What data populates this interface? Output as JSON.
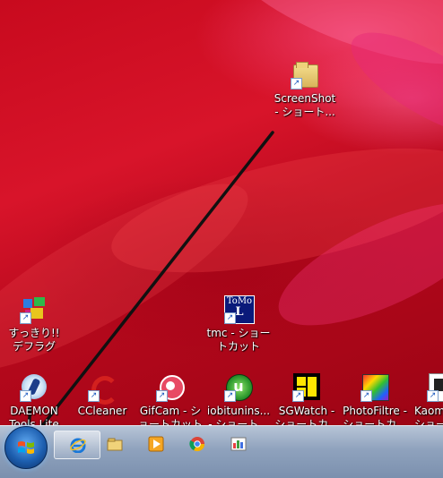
{
  "desktop": {
    "icons": [
      {
        "label": "ScreenShot\n- ショート...",
        "icon": "folder-icon"
      },
      {
        "label": "すっきり!!\nデフラグ",
        "icon": "defrag-icon"
      },
      {
        "label": "tmc - ショー\nトカット",
        "icon": "tomo-icon"
      },
      {
        "label": "DAEMON\nTools Lite",
        "icon": "daemon-tools-icon"
      },
      {
        "label": "CCleaner",
        "icon": "ccleaner-icon"
      },
      {
        "label": "GifCam - シ\nョートカット",
        "icon": "gifcam-icon"
      },
      {
        "label": "iobitunins...\n- ショート...",
        "icon": "iobit-uninstaller-icon"
      },
      {
        "label": "SGWatch -\nショートカ...",
        "icon": "sgwatch-icon"
      },
      {
        "label": "PhotoFiltre -\nショートカ...",
        "icon": "photofiltre-icon"
      },
      {
        "label": "Kaom\nショー",
        "icon": "kaomoji-icon"
      }
    ],
    "arrow_annotation": "black-arrow-to-start-button"
  },
  "taskbar": {
    "start_button": "windows-start-orb",
    "pinned": [
      "internet-explorer-icon",
      "explorer-folder-icon",
      "media-player-icon",
      "chrome-icon",
      "paint-icon"
    ]
  },
  "colors": {
    "wallpaper": "#c80a1e",
    "taskbar": "#8fa2bd",
    "arrow": "#111111"
  }
}
